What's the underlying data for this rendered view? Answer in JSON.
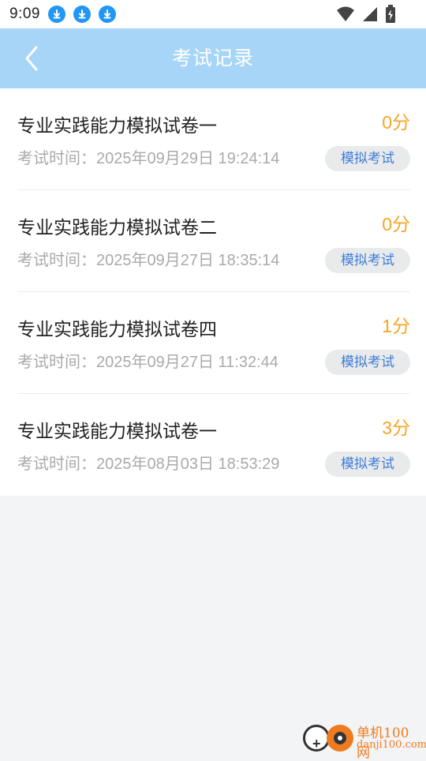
{
  "status_bar": {
    "time": "9:09",
    "notifications": [
      "download-icon",
      "download-icon",
      "download-icon"
    ],
    "icons": [
      "wifi-icon",
      "signal-icon",
      "battery-icon"
    ]
  },
  "header": {
    "title": "考试记录",
    "back_icon": "chevron-left-icon",
    "background": "#a6d5f7"
  },
  "records": [
    {
      "title": "专业实践能力模拟试卷一",
      "score": "0分",
      "time_label": "考试时间：",
      "time": "2025年09月29日 19:24:14",
      "tag": "模拟考试"
    },
    {
      "title": "专业实践能力模拟试卷二",
      "score": "0分",
      "time_label": "考试时间：",
      "time": "2025年09月27日 18:35:14",
      "tag": "模拟考试"
    },
    {
      "title": "专业实践能力模拟试卷四",
      "score": "1分",
      "time_label": "考试时间：",
      "time": "2025年09月27日 11:32:44",
      "tag": "模拟考试"
    },
    {
      "title": "专业实践能力模拟试卷一",
      "score": "3分",
      "time_label": "考试时间：",
      "time": "2025年08月03日 18:53:29",
      "tag": "模拟考试"
    }
  ],
  "watermark": {
    "name": "单机100网",
    "url": "danji100.com"
  },
  "colors": {
    "score": "#f5a623",
    "tag_text": "#3f7ed8",
    "accent_blue": "#2196f3"
  }
}
